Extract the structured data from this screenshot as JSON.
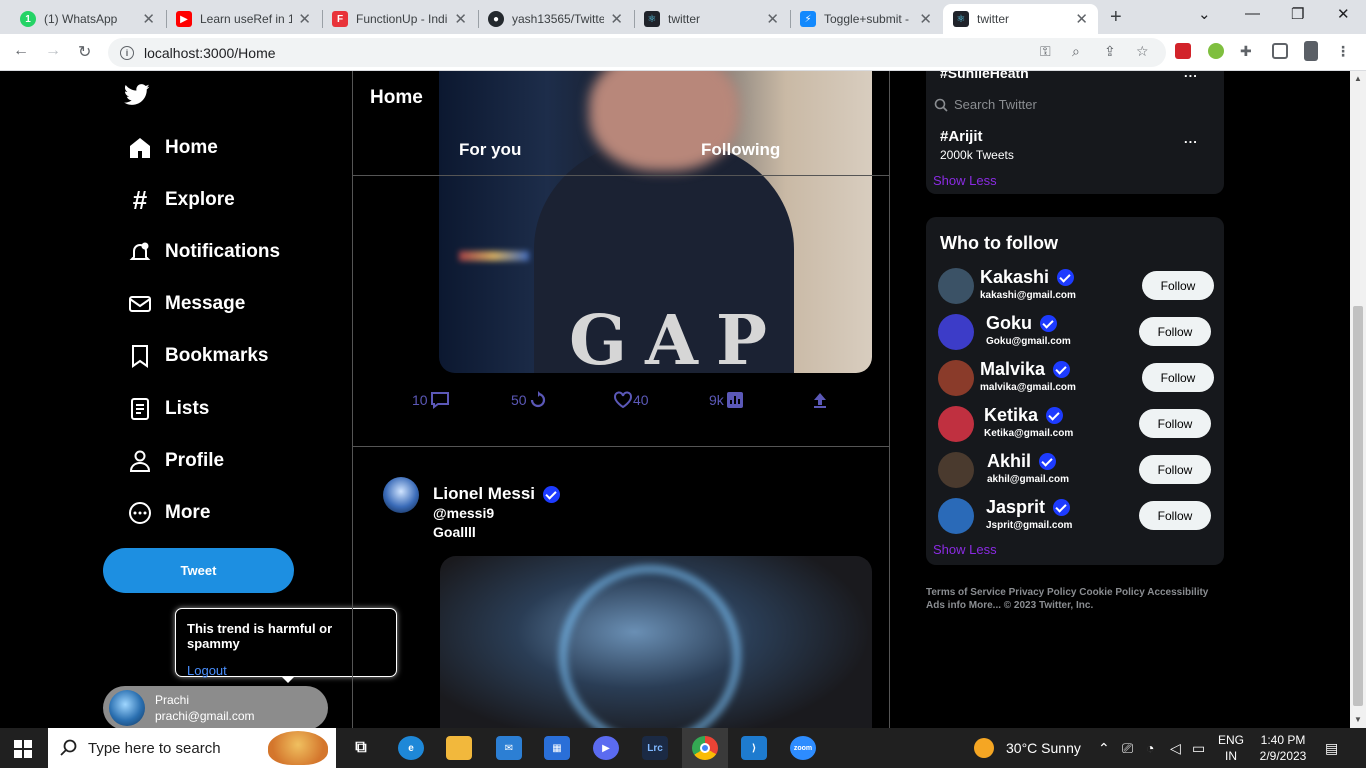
{
  "browser": {
    "tabs": [
      {
        "title": "(1) WhatsApp",
        "icon": "whatsapp-icon",
        "color": "#25d366",
        "active": false
      },
      {
        "title": "Learn useRef in 1",
        "icon": "youtube-icon",
        "color": "#ff0000",
        "active": false
      },
      {
        "title": "FunctionUp - Indi",
        "icon": "functionup-icon",
        "color": "#e8333a",
        "active": false
      },
      {
        "title": "yash13565/Twitte",
        "icon": "github-icon",
        "color": "#24292e",
        "active": false
      },
      {
        "title": "twitter",
        "icon": "react-icon",
        "color": "#20232a",
        "active": false
      },
      {
        "title": "Toggle+submit -",
        "icon": "stackblitz-icon",
        "color": "#1389fd",
        "active": false
      },
      {
        "title": "twitter",
        "icon": "react-icon",
        "color": "#20232a",
        "active": true
      }
    ],
    "url": "localhost:3000/Home"
  },
  "sidebar": {
    "items": [
      {
        "label": "Home",
        "icon": "home-icon"
      },
      {
        "label": "Explore",
        "icon": "hashtag-icon"
      },
      {
        "label": "Notifications",
        "icon": "bell-icon"
      },
      {
        "label": "Message",
        "icon": "mail-icon"
      },
      {
        "label": "Bookmarks",
        "icon": "bookmark-icon"
      },
      {
        "label": "Lists",
        "icon": "list-icon"
      },
      {
        "label": "Profile",
        "icon": "person-icon"
      },
      {
        "label": "More",
        "icon": "more-circle-icon"
      }
    ],
    "tweet_label": "Tweet",
    "popup_text": "This trend is harmful or spammy",
    "logout_label": "Logout",
    "account": {
      "name": "Prachi",
      "email": "prachi@gmail.com"
    }
  },
  "feed": {
    "title": "Home",
    "tabs": [
      "For you",
      "Following"
    ],
    "post1_actions": {
      "replies": "10",
      "retweets": "50",
      "likes": "40",
      "views": "9k"
    },
    "post2": {
      "name": "Lionel Messi",
      "handle": "@messi9",
      "text": "Goallll"
    }
  },
  "trends": {
    "top_partial": "#SunileHeath",
    "search_placeholder": "Search Twitter",
    "trend_name": "#Arijit",
    "trend_count": "2000k Tweets",
    "more_label": "...",
    "show_less": "Show Less"
  },
  "who_to_follow": {
    "title": "Who to follow",
    "follow_label": "Follow",
    "show_less": "Show Less",
    "people": [
      {
        "name": "Kakashi",
        "email": "kakashi@gmail.com",
        "color": "#3b5266"
      },
      {
        "name": "Goku",
        "email": "Goku@gmail.com",
        "color": "#3c3cc8"
      },
      {
        "name": "Malvika",
        "email": "malvika@gmail.com",
        "color": "#8a3b2a"
      },
      {
        "name": "Ketika",
        "email": "Ketika@gmail.com",
        "color": "#c03040"
      },
      {
        "name": "Akhil",
        "email": "akhil@gmail.com",
        "color": "#4a3a2e"
      },
      {
        "name": "Jasprit",
        "email": "Jsprit@gmail.com",
        "color": "#2a6ab8"
      }
    ]
  },
  "footer": {
    "text": "Terms of Service Privacy Policy Cookie Policy Accessibility Ads info More... © 2023 Twitter, Inc."
  },
  "taskbar": {
    "search_placeholder": "Type here to search",
    "weather": "30°C  Sunny",
    "lang_line1": "ENG",
    "lang_line2": "IN",
    "time": "1:40 PM",
    "date": "2/9/2023"
  },
  "colors": {
    "accent": "#1d8fe1",
    "action": "#5b58b7",
    "show_less": "#8a2be2"
  }
}
